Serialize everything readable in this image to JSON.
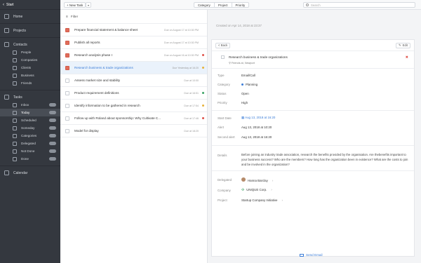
{
  "sidebar": {
    "back_label": "Start",
    "items": [
      {
        "label": "Home"
      },
      {
        "label": "Projects"
      },
      {
        "label": "Contacts"
      }
    ],
    "contacts_sub": [
      {
        "label": "People"
      },
      {
        "label": "Companies"
      },
      {
        "label": "Clients"
      },
      {
        "label": "Business"
      },
      {
        "label": "Friends"
      }
    ],
    "tasks_label": "Tasks",
    "tasks_sub": [
      {
        "label": "Inbox"
      },
      {
        "label": "Today"
      },
      {
        "label": "Scheduled"
      },
      {
        "label": "Someday"
      },
      {
        "label": "Categories"
      },
      {
        "label": "Delegated"
      },
      {
        "label": "Not Done"
      },
      {
        "label": "Done"
      }
    ],
    "calendar_label": "Calendar"
  },
  "toolbar": {
    "new_task_label": "+ New Task",
    "tabs": [
      "Category",
      "Project",
      "Priority"
    ],
    "search_placeholder": "Search"
  },
  "list": {
    "filter_label": "Filter",
    "tasks": [
      {
        "title": "Prepare financial statement & balance sheet",
        "due": "Due on August 17 at 10:30 PM",
        "flag": "red"
      },
      {
        "title": "Publish all reports",
        "due": "Due on August 17 at 10:30 PM",
        "flag": "red"
      },
      {
        "title": "Research analysis phase I",
        "due": "Due on August 16 at 10:30 PM",
        "flag": "red"
      },
      {
        "title": "Research business & trade organizations",
        "due": "Due Yesterday at 16:20",
        "flag": "red"
      },
      {
        "title": "Assess market size and stability",
        "due": "Due at 10:00",
        "flag": ""
      },
      {
        "title": "Product requirement definitions",
        "due": "Due at 16:51",
        "flag": ""
      },
      {
        "title": "Identify information to be gathered in research",
        "due": "Due at 17:54",
        "flag": ""
      },
      {
        "title": "Follow up with Roland about sponsorship: Why Cultivate C...",
        "due": "Due at 17:46",
        "flag": ""
      },
      {
        "title": "Model for display",
        "due": "Due at 18:20",
        "flag": ""
      }
    ]
  },
  "detail": {
    "created": "Created on Apr 14, 2018 at 23:37",
    "back_label": "< Back",
    "edit_label": "Edit",
    "title": "Research business & trade organizations",
    "subtitle": "Friends at, Newport",
    "fields": {
      "type_label": "Type",
      "type_value": "Email/Call",
      "category_label": "Category",
      "category_value": "Planning",
      "status_label": "Status",
      "status_value": "Open",
      "priority_label": "Priority",
      "priority_value": "High",
      "start_label": "Start Date",
      "start_value": "Aug 13, 2018 at 16:20",
      "alert_label": "Alert",
      "alert_value": "Aug 13, 2018 at 10:20",
      "second_label": "Second alert",
      "second_value": "Aug 13, 2018 at 16:20",
      "details_label": "Details",
      "details_value": "Before joining an industry trade association, research the benefits provided by the organisation. Are thebenefits important to your business success? Who are the members? How long has the organization been in existence? What are the costs to join and be involved in the organization?",
      "delegated_label": "Delegated",
      "delegated_value": "Hanna Barclay",
      "company_label": "Company",
      "company_value": "UNIQUE Corp.",
      "project_label": "Project",
      "project_value": "Startup Company Initiative"
    },
    "send_email_label": "Send Email"
  },
  "colors": {
    "accent": "#3b7dd8",
    "flag_red": "#e06c5a",
    "sidebar_bg": "#34383f"
  }
}
